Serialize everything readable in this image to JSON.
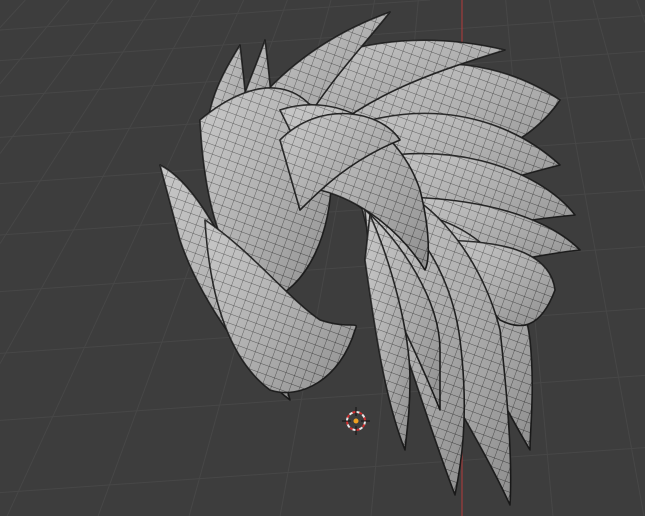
{
  "viewport": {
    "mode": "3d-viewport",
    "background_color": "#3d3d3d",
    "grid_color": "#4a4a4a",
    "x_axis_color": "#b03a3a",
    "mesh_color": "#b9b9b9",
    "wire_color": "#1e1e1e",
    "object": "hair-mesh",
    "cursor_icon": "3d-cursor-icon"
  }
}
